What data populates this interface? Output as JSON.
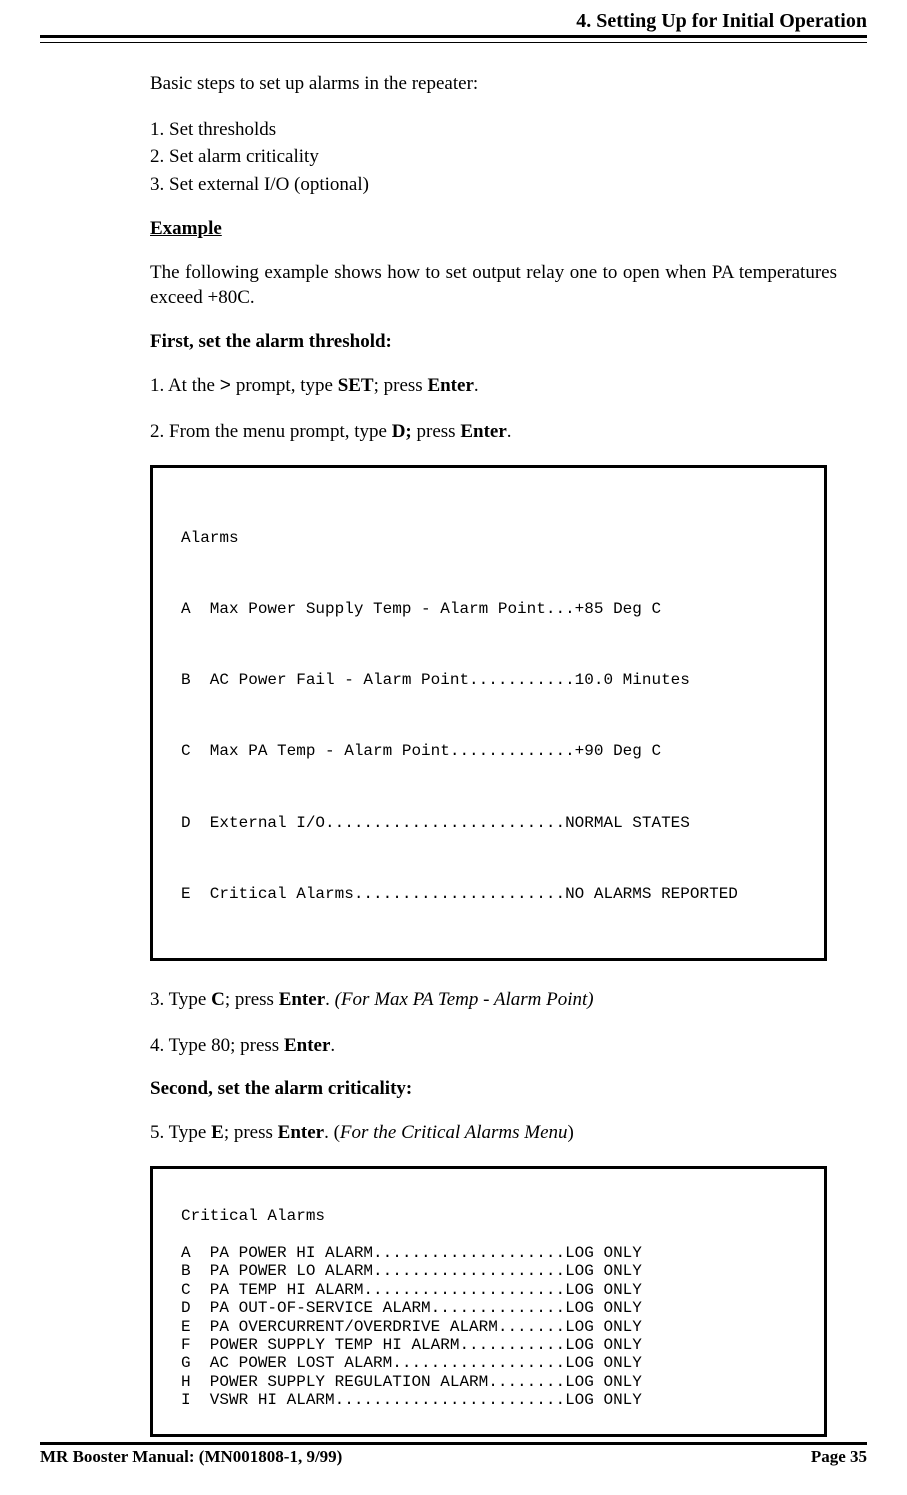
{
  "header": {
    "section_title": "4. Setting Up for Initial Operation"
  },
  "body": {
    "intro": "Basic steps to set up alarms in the repeater:",
    "basic_steps": [
      "1.   Set thresholds",
      "2.   Set alarm criticality",
      "3.   Set external I/O (optional)"
    ],
    "example_heading": "Example",
    "example_intro": "The following example shows how to set output relay one to open when PA temperatures exceed +80C.",
    "first_heading": "First, set the alarm threshold:",
    "steps_a": {
      "s1_pre": "1.   At the ",
      "s1_prompt": ">",
      "s1_mid": " prompt, type ",
      "s1_cmd": "SET",
      "s1_mid2": "; press ",
      "s1_enter": "Enter",
      "s1_end": ".",
      "s2_pre": "2.   From the menu prompt, type ",
      "s2_cmd": "D;",
      "s2_mid": " press ",
      "s2_enter": "Enter",
      "s2_end": "."
    },
    "codebox1": {
      "title": "Alarms",
      "lines": [
        "A  Max Power Supply Temp - Alarm Point...+85 Deg C",
        "B  AC Power Fail - Alarm Point...........10.0 Minutes",
        "C  Max PA Temp - Alarm Point.............+90 Deg C",
        "D  External I/O.........................NORMAL STATES",
        "E  Critical Alarms......................NO ALARMS REPORTED"
      ]
    },
    "steps_b": {
      "s3_pre": "3.   Type ",
      "s3_cmd": "C",
      "s3_mid": "; press ",
      "s3_enter": "Enter",
      "s3_post": ". ",
      "s3_note": "(For Max PA Temp - Alarm Point)",
      "s4_pre": "4.   Type 80; press ",
      "s4_enter": "Enter",
      "s4_end": "."
    },
    "second_heading": "Second, set the alarm criticality:",
    "steps_c": {
      "s5_pre": "5.   Type ",
      "s5_cmd": "E",
      "s5_mid": "; press ",
      "s5_enter": "Enter",
      "s5_post": ". (",
      "s5_note": "For the Critical Alarms Menu",
      "s5_end": ")"
    },
    "codebox2": {
      "title": "Critical Alarms",
      "lines": [
        "A  PA POWER HI ALARM....................LOG ONLY",
        "B  PA POWER LO ALARM....................LOG ONLY",
        "C  PA TEMP HI ALARM.....................LOG ONLY",
        "D  PA OUT-OF-SERVICE ALARM..............LOG ONLY",
        "E  PA OVERCURRENT/OVERDRIVE ALARM.......LOG ONLY",
        "F  POWER SUPPLY TEMP HI ALARM...........LOG ONLY",
        "G  AC POWER LOST ALARM..................LOG ONLY",
        "H  POWER SUPPLY REGULATION ALARM........LOG ONLY",
        "I  VSWR HI ALARM........................LOG ONLY"
      ]
    }
  },
  "footer": {
    "manual": "MR Booster Manual: (MN001808-1, 9/99)",
    "page": "Page 35"
  }
}
